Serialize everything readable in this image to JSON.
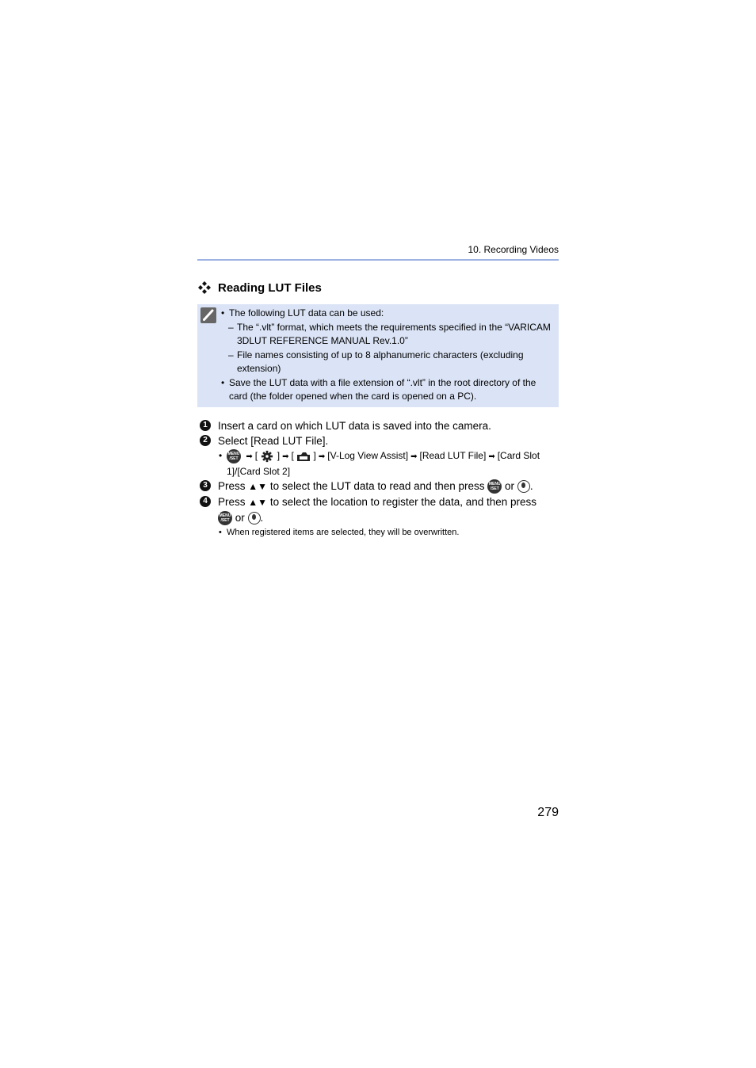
{
  "header": {
    "chapter": "10. Recording Videos"
  },
  "section": {
    "icon": "diamond-cluster-icon",
    "title": "Reading LUT Files"
  },
  "note": {
    "icon": "pencil-note-icon",
    "items": [
      {
        "type": "bullet",
        "text": "The following LUT data can be used:"
      },
      {
        "type": "dash",
        "text": "The “.vlt” format, which meets the requirements specified in the “VARICAM 3DLUT REFERENCE MANUAL Rev.1.0”"
      },
      {
        "type": "dash",
        "text": "File names consisting of up to 8 alphanumeric characters (excluding extension)"
      },
      {
        "type": "bullet",
        "text": "Save the LUT data with a file extension of “.vlt” in the root directory of the card (the folder opened when the card is opened on a PC)."
      }
    ]
  },
  "steps": [
    {
      "num": "1",
      "text": "Insert a card on which LUT data is saved into the camera."
    },
    {
      "num": "2",
      "text": "Select [Read LUT File]."
    },
    {
      "num": "3",
      "pre": "Press",
      "arrows": "▲▼",
      "text": "to select the LUT data to read and then press",
      "or": "or",
      "end": "."
    },
    {
      "num": "4",
      "pre": "Press",
      "arrows": "▲▼",
      "text": "to select the location to register the data, and then press",
      "or": "or",
      "end": "."
    }
  ],
  "menu_path": {
    "menu_button": "MENU/SET",
    "bracket_open": "[",
    "bracket_close": "]",
    "items": [
      "[V-Log View Assist]",
      "[Read LUT File]",
      "[Card Slot 1]/[Card Slot 2]"
    ]
  },
  "step4_note": "When registered items are selected, they will be overwritten.",
  "menu_button_label": {
    "line1": "MENU",
    "line2": "/SET"
  },
  "page_number": "279"
}
